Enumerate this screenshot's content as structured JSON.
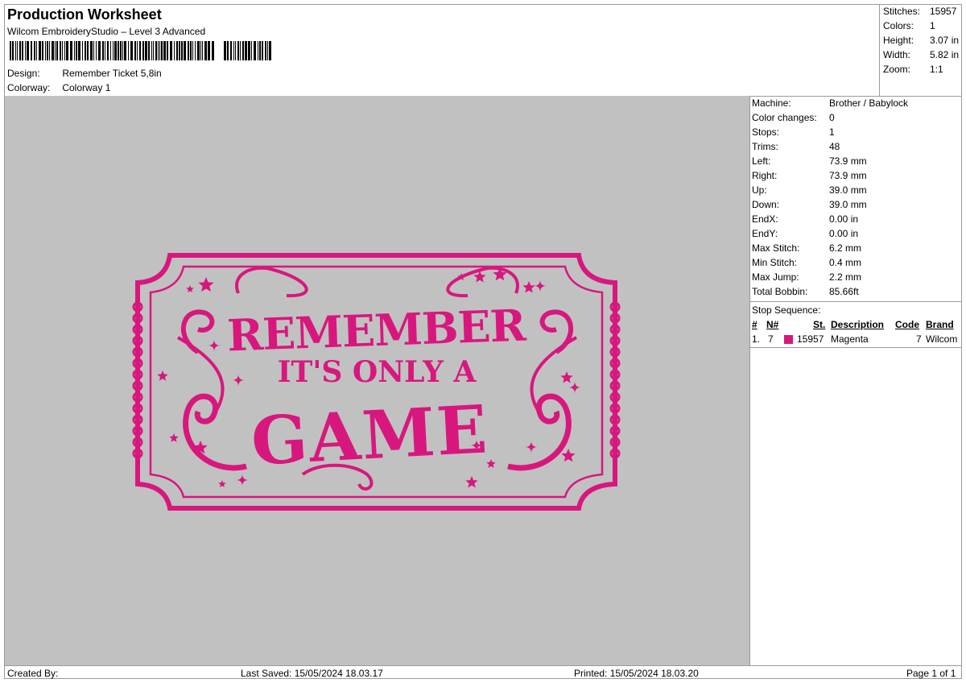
{
  "header": {
    "title": "Production Worksheet",
    "subtitle": "Wilcom EmbroideryStudio – Level 3 Advanced",
    "design_label": "Design:",
    "design_value": "Remember Ticket 5,8in",
    "colorway_label": "Colorway:",
    "colorway_value": "Colorway 1"
  },
  "summary": [
    {
      "label": "Stitches:",
      "value": "15957"
    },
    {
      "label": "Colors:",
      "value": "1"
    },
    {
      "label": "Height:",
      "value": "3.07 in"
    },
    {
      "label": "Width:",
      "value": "5.82 in"
    },
    {
      "label": "Zoom:",
      "value": "1:1"
    }
  ],
  "machine_info": [
    {
      "label": "Machine:",
      "value": "Brother / Babylock"
    },
    {
      "label": "Color changes:",
      "value": "0"
    },
    {
      "label": "Stops:",
      "value": "1"
    },
    {
      "label": "Trims:",
      "value": "48"
    },
    {
      "label": "Left:",
      "value": "73.9 mm"
    },
    {
      "label": "Right:",
      "value": "73.9 mm"
    },
    {
      "label": "Up:",
      "value": "39.0 mm"
    },
    {
      "label": "Down:",
      "value": "39.0 mm"
    },
    {
      "label": "EndX:",
      "value": "0.00 in"
    },
    {
      "label": "EndY:",
      "value": "0.00 in"
    },
    {
      "label": "Max Stitch:",
      "value": "6.2 mm"
    },
    {
      "label": "Min Stitch:",
      "value": "0.4 mm"
    },
    {
      "label": "Max Jump:",
      "value": "2.2 mm"
    },
    {
      "label": "Total Bobbin:",
      "value": "85.66ft"
    }
  ],
  "stop_sequence": {
    "title": "Stop Sequence:",
    "columns": [
      "#",
      "N#",
      "St.",
      "Description",
      "Code",
      "Brand"
    ],
    "rows": [
      {
        "num": "1.",
        "n": "7",
        "stitches": "15957",
        "description": "Magenta",
        "code": "7",
        "brand": "Wilcom",
        "color": "#d8177e"
      }
    ]
  },
  "design": {
    "line1": "REMEMBER",
    "line2": "IT'S ONLY A",
    "line3": "GAME",
    "thread_color": "#d8177e",
    "background": "#c1c1c1"
  },
  "footer": {
    "created_by": "Created By:",
    "last_saved": "Last Saved: 15/05/2024 18.03.17",
    "printed": "Printed: 15/05/2024 18.03.20",
    "page": "Page 1 of 1"
  }
}
